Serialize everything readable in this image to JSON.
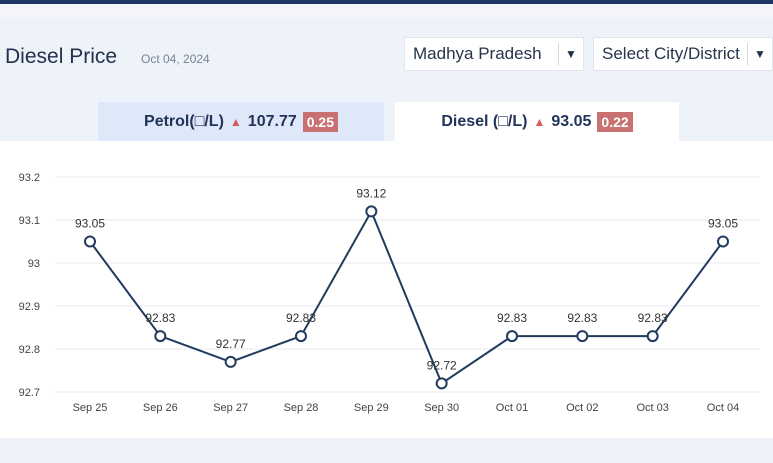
{
  "header": {
    "title": "Diesel Price",
    "date": "Oct 04, 2024"
  },
  "filters": {
    "state": "Madhya Pradesh",
    "city": "Select City/District",
    "dropdown_icon": "caret-down-icon"
  },
  "tabs": [
    {
      "label": "Petrol(□/L)",
      "trend_icon": "up-triangle-icon",
      "trend_symbol": "▲",
      "price": "107.77",
      "change": "0.25",
      "active": false
    },
    {
      "label": "Diesel (□/L)",
      "trend_icon": "up-triangle-icon",
      "trend_symbol": "▲",
      "price": "93.05",
      "change": "0.22",
      "active": true
    }
  ],
  "colors": {
    "line": "#213b5e",
    "grid": "#e6e9ef",
    "trend_up": "#d95a5a",
    "change_badge": "#c97070"
  },
  "chart_data": {
    "type": "line",
    "categories": [
      "Sep 25",
      "Sep 26",
      "Sep 27",
      "Sep 28",
      "Sep 29",
      "Sep 30",
      "Oct 01",
      "Oct 02",
      "Oct 03",
      "Oct 04"
    ],
    "values": [
      93.05,
      92.83,
      92.77,
      92.83,
      93.12,
      92.72,
      92.83,
      92.83,
      92.83,
      93.05
    ],
    "data_labels": [
      "93.05",
      "92.83",
      "92.77",
      "92.83",
      "93.12",
      "92.72",
      "92.83",
      "92.83",
      "92.83",
      "93.05"
    ],
    "y_ticks": [
      "93.2",
      "93.1",
      "93",
      "92.9",
      "92.8",
      "92.7"
    ],
    "ylim": [
      92.7,
      93.2
    ],
    "grid": true
  }
}
